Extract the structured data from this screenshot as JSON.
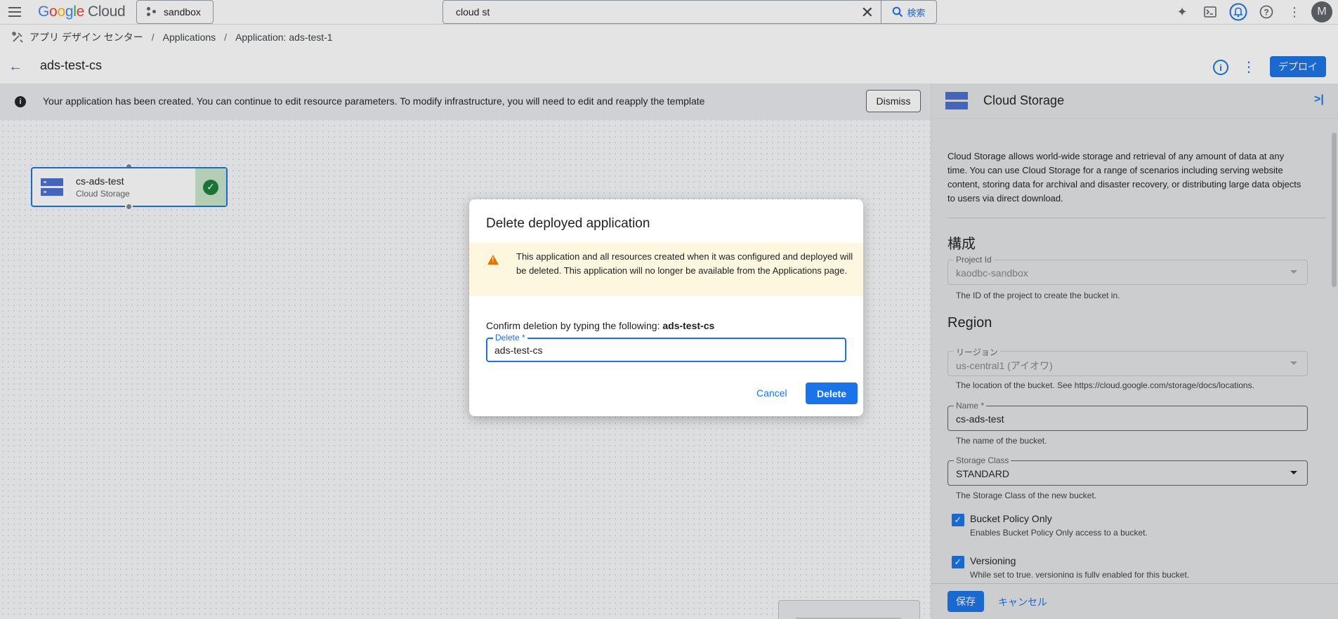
{
  "header": {
    "logo_google": "Google",
    "logo_cloud": "Cloud",
    "project": "sandbox",
    "search_value": "cloud st",
    "search_button": "検索",
    "avatar_letter": "M"
  },
  "breadcrumb": {
    "items": [
      "アプリ デザイン センター",
      "Applications",
      "Application:  ads-test-1"
    ]
  },
  "titlebar": {
    "title": "ads-test-cs",
    "deploy_label": "デプロイ"
  },
  "banner": {
    "text": "Your application has been created. You can continue to edit resource parameters. To modify infrastructure, you will need to edit and reapply the template",
    "dismiss_label": "Dismiss"
  },
  "node": {
    "name": "cs-ads-test",
    "type": "Cloud Storage"
  },
  "panel": {
    "title": "Cloud Storage",
    "description": "Cloud Storage allows world-wide storage and retrieval of any amount of data at any time. You can use Cloud Storage for a range of scenarios including serving website content, storing data for archival and disaster recovery, or distributing large data objects to users via direct download.",
    "section_config": "構成",
    "project_id_label": "Project Id",
    "project_id_value": "kaodbc-sandbox",
    "project_id_hint": "The ID of the project to create the bucket in.",
    "section_region": "Region",
    "region_label": "リージョン",
    "region_value": "us-central1 (アイオワ)",
    "region_hint": "The location of the bucket. See https://cloud.google.com/storage/docs/locations.",
    "name_label": "Name *",
    "name_value": "cs-ads-test",
    "name_hint": "The name of the bucket.",
    "storage_class_label": "Storage Class",
    "storage_class_value": "STANDARD",
    "storage_class_hint": "The Storage Class of the new bucket.",
    "bucket_policy_label": "Bucket Policy Only",
    "bucket_policy_hint": "Enables Bucket Policy Only access to a bucket.",
    "versioning_label": "Versioning",
    "versioning_hint": "While set to true, versioning is fully enabled for this bucket.",
    "save_label": "保存",
    "cancel_label": "キャンセル"
  },
  "dialog": {
    "title": "Delete deployed application",
    "warning": "This application and all resources created when it was configured and deployed will be deleted. This application will no longer be available from the Applications page.",
    "confirm_prefix": "Confirm deletion by typing the following: ",
    "confirm_name": "ads-test-cs",
    "field_label": "Delete *",
    "field_value": "ads-test-cs",
    "cancel_label": "Cancel",
    "delete_label": "Delete"
  }
}
